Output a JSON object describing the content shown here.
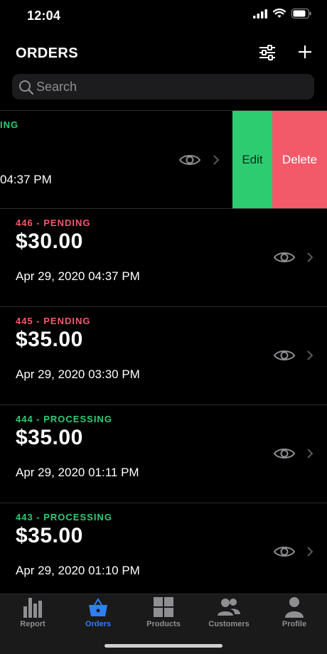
{
  "status_bar": {
    "time": "12:04"
  },
  "header": {
    "title": "ORDERS"
  },
  "search": {
    "placeholder": "Search"
  },
  "swiped_row": {
    "status": "ING",
    "time_fragment": "04:37 PM",
    "status_color": "#2ecc71",
    "edit_label": "Edit",
    "delete_label": "Delete"
  },
  "orders": [
    {
      "status": "446 - PENDING",
      "status_color": "#f25a6a",
      "amount": "$30.00",
      "date": "Apr 29, 2020 04:37 PM"
    },
    {
      "status": "445 - PENDING",
      "status_color": "#f25a6a",
      "amount": "$35.00",
      "date": "Apr 29, 2020 03:30 PM"
    },
    {
      "status": "444 - PROCESSING",
      "status_color": "#2ecc71",
      "amount": "$35.00",
      "date": "Apr 29, 2020 01:11 PM"
    },
    {
      "status": "443 - PROCESSING",
      "status_color": "#2ecc71",
      "amount": "$35.00",
      "date": "Apr 29, 2020 01:10 PM"
    }
  ],
  "tabs": [
    {
      "label": "Report",
      "icon": "bar-chart-icon",
      "active": false
    },
    {
      "label": "Orders",
      "icon": "basket-icon",
      "active": true
    },
    {
      "label": "Products",
      "icon": "grid-icon",
      "active": false
    },
    {
      "label": "Customers",
      "icon": "people-icon",
      "active": false
    },
    {
      "label": "Profile",
      "icon": "person-icon",
      "active": false
    }
  ],
  "colors": {
    "accent": "#2f7ff6",
    "pending": "#f25a6a",
    "processing": "#2ecc71"
  }
}
